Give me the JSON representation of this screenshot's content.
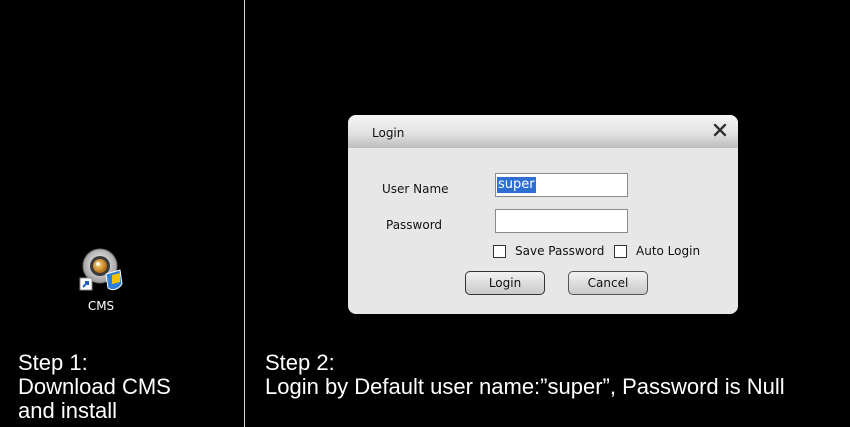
{
  "desktop": {
    "icon_label": "CMS",
    "icon_name": "cms-app-icon"
  },
  "steps": {
    "step1": {
      "title": "Step 1:",
      "line1": "Download CMS",
      "line2": "and install"
    },
    "step2": {
      "title": "Step 2:",
      "line1": "Login by Default user name:”super”, Password is Null"
    }
  },
  "dialog": {
    "title": "Login",
    "close_glyph": "X",
    "username_label": "User Name",
    "username_value": "super",
    "password_label": "Password",
    "password_value": "",
    "save_password_label": "Save Password",
    "save_password_checked": false,
    "auto_login_label": "Auto Login",
    "auto_login_checked": false,
    "login_button": "Login",
    "cancel_button": "Cancel"
  },
  "colors": {
    "background": "#000000",
    "dialog_bg": "#e7e7e7",
    "selection": "#2f6fd2"
  }
}
